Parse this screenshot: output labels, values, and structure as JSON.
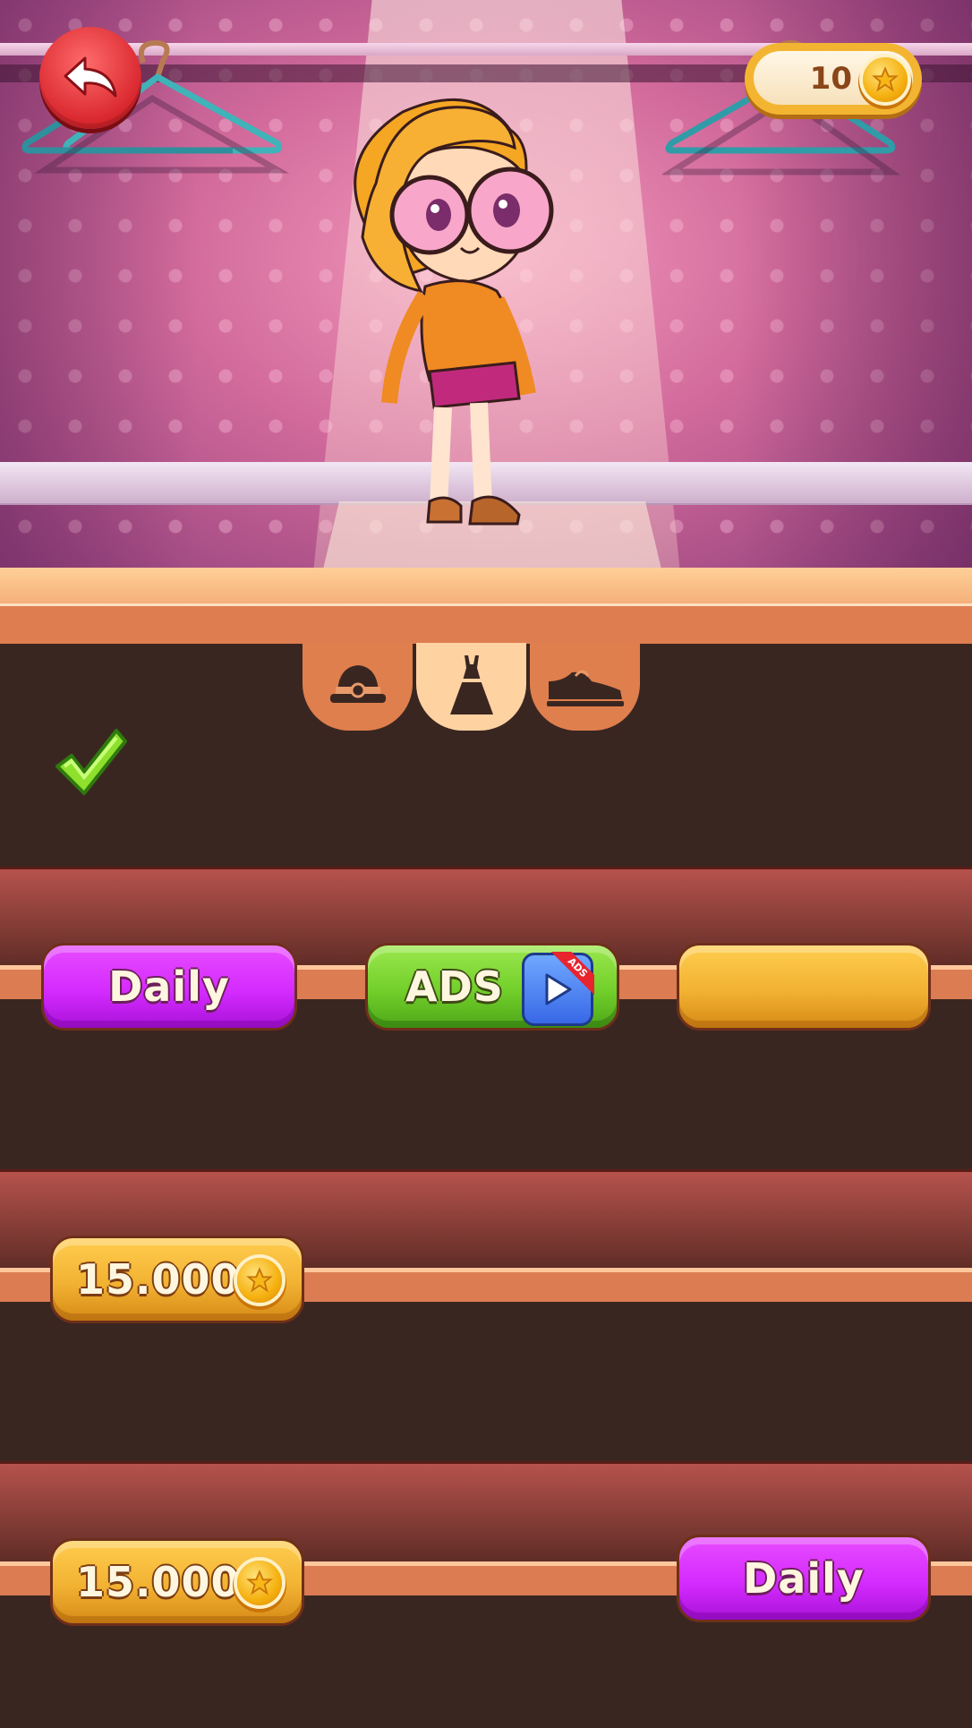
{
  "header": {
    "back_button": "back-arrow-icon",
    "coins": "10"
  },
  "tabs": [
    {
      "icon": "hat-icon",
      "active": false
    },
    {
      "icon": "dress-icon",
      "active": true
    },
    {
      "icon": "shoe-icon",
      "active": false
    }
  ],
  "shelf": {
    "equipped_indicator": "checkmark-icon",
    "row1": {
      "left_button": "Daily",
      "center_button": "ADS",
      "center_badge": "ADS",
      "right_button": ""
    },
    "row2": {
      "left_price": "15.000"
    },
    "row3": {
      "left_price": "15.000",
      "right_button": "Daily"
    }
  },
  "colors": {
    "purple": "#d52bff",
    "green": "#72cf2a",
    "gold": "#f2b232",
    "shelf_dark": "#3a2621",
    "back_red": "#d8262d"
  }
}
